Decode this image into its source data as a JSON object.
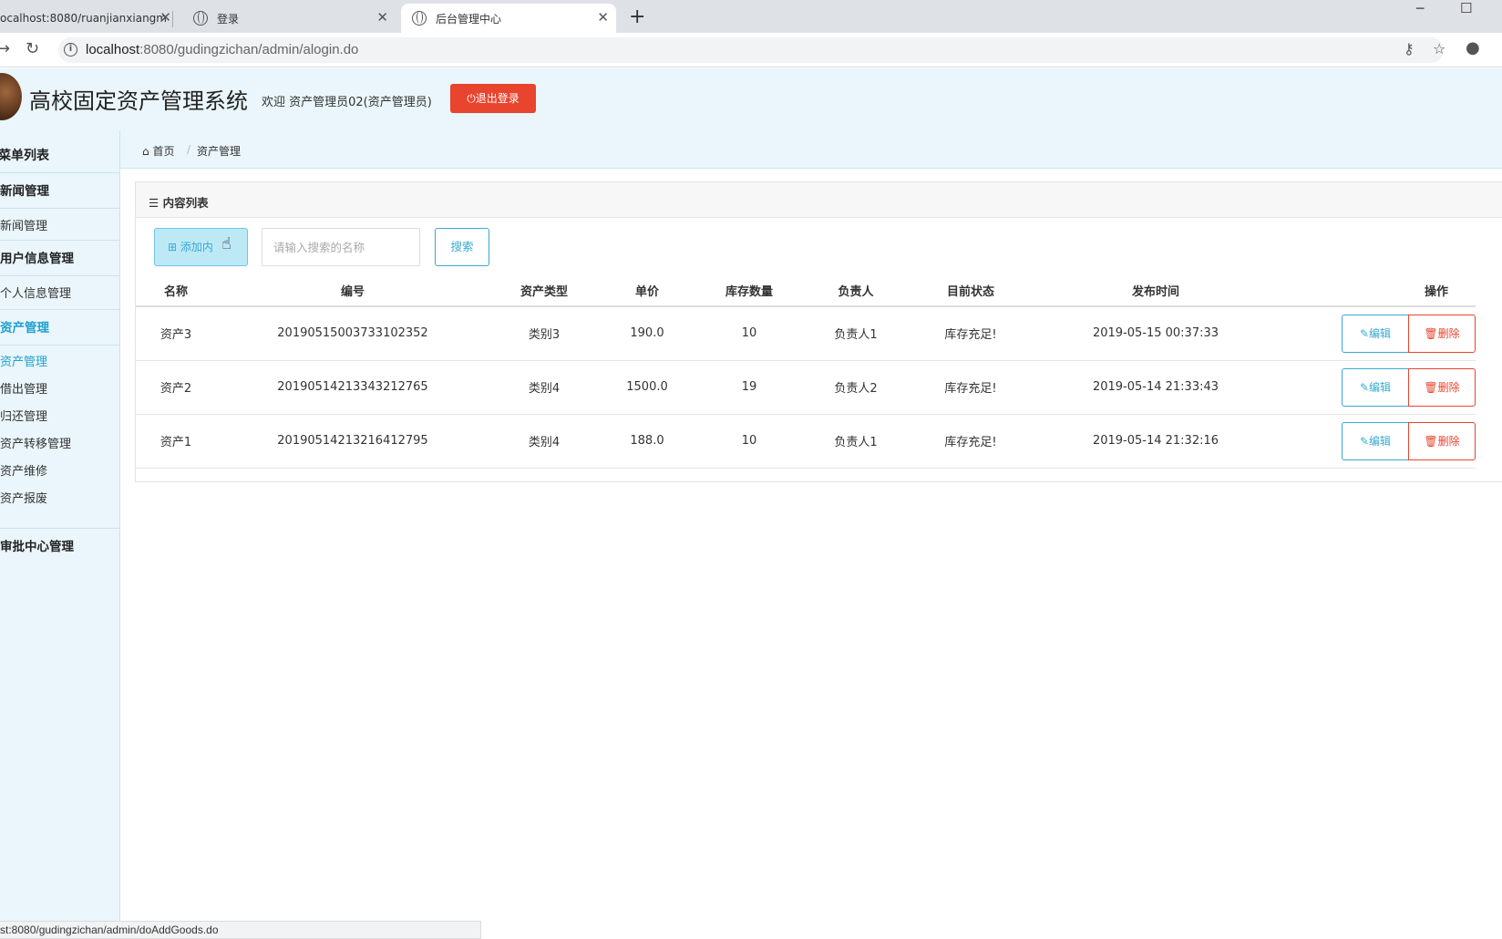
{
  "browser": {
    "tabs": [
      {
        "title": "ocalhost:8080/ruanjianxiangm"
      },
      {
        "title": "登录"
      },
      {
        "title": "后台管理中心"
      }
    ],
    "new_tab": "+",
    "url_host": "localhost",
    "url_rest": ":8080/gudingzichan/admin/alogin.do",
    "status_url": "st:8080/gudingzichan/admin/doAddGoods.do"
  },
  "header": {
    "title": "高校固定资产管理系统",
    "welcome": "欢迎 资产管理员02(资产管理员)",
    "logout": "退出登录"
  },
  "sidebar": {
    "title": "菜单列表",
    "groups": [
      {
        "label": "新闻管理",
        "items": [
          {
            "label": "新闻管理"
          }
        ]
      },
      {
        "label": "用户信息管理",
        "items": [
          {
            "label": "个人信息管理"
          }
        ]
      },
      {
        "label": "资产管理",
        "items": [
          {
            "label": "资产管理"
          },
          {
            "label": "借出管理"
          },
          {
            "label": "归还管理"
          },
          {
            "label": "资产转移管理"
          },
          {
            "label": "资产维修"
          },
          {
            "label": "资产报废"
          }
        ]
      },
      {
        "label": "审批中心管理",
        "items": []
      }
    ]
  },
  "breadcrumb": {
    "home": "首页",
    "current": "资产管理"
  },
  "panel": {
    "title": "内容列表",
    "add_label": "添加内",
    "search_placeholder": "请输入搜索的名称",
    "search_label": "搜索"
  },
  "table": {
    "headers": [
      "名称",
      "编号",
      "资产类型",
      "单价",
      "库存数量",
      "负责人",
      "目前状态",
      "发布时间",
      "操作"
    ],
    "rows": [
      [
        "资产3",
        "20190515003733102352",
        "类别3",
        "190.0",
        "10",
        "负责人1",
        "库存充足!",
        "2019-05-15 00:37:33"
      ],
      [
        "资产2",
        "20190514213343212765",
        "类别4",
        "1500.0",
        "19",
        "负责人2",
        "库存充足!",
        "2019-05-14 21:33:43"
      ],
      [
        "资产1",
        "20190514213216412795",
        "类别4",
        "188.0",
        "10",
        "负责人1",
        "库存充足!",
        "2019-05-14 21:32:16"
      ]
    ],
    "edit_label": "编辑",
    "delete_label": "删除"
  }
}
